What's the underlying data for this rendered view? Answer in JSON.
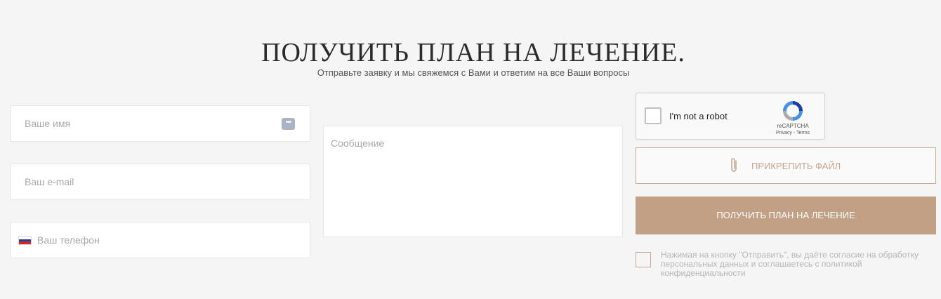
{
  "header": {
    "title": "ПОЛУЧИТЬ ПЛАН НА ЛЕЧЕНИЕ.",
    "subtitle": "Отправьте заявку и мы свяжемся с Вами и ответим на все Ваши вопросы"
  },
  "form": {
    "name_placeholder": "Ваше имя",
    "email_placeholder": "Ваш e-mail",
    "phone_placeholder": "Ваш телефон",
    "message_placeholder": "Сообщение",
    "name_icon": "dots-icon",
    "phone_flag_icon": "russia-flag-icon"
  },
  "recaptcha": {
    "label": "I'm not a robot",
    "brand": "reCAPTCHA",
    "terms": "Privacy - Terms"
  },
  "buttons": {
    "attach_label": "ПРИКРЕПИТЬ ФАЙЛ",
    "attach_icon": "paperclip-icon",
    "submit_label": "ПОЛУЧИТЬ ПЛАН НА ЛЕЧЕНИЕ"
  },
  "consent": {
    "text": "Нажимая на кнопку \"Отправить\", вы даёте согласие на обработку персональных данных и соглашаетесь с политикой конфиденциальности"
  },
  "colors": {
    "accent": "#c2a086",
    "background": "#f5f5f5"
  }
}
